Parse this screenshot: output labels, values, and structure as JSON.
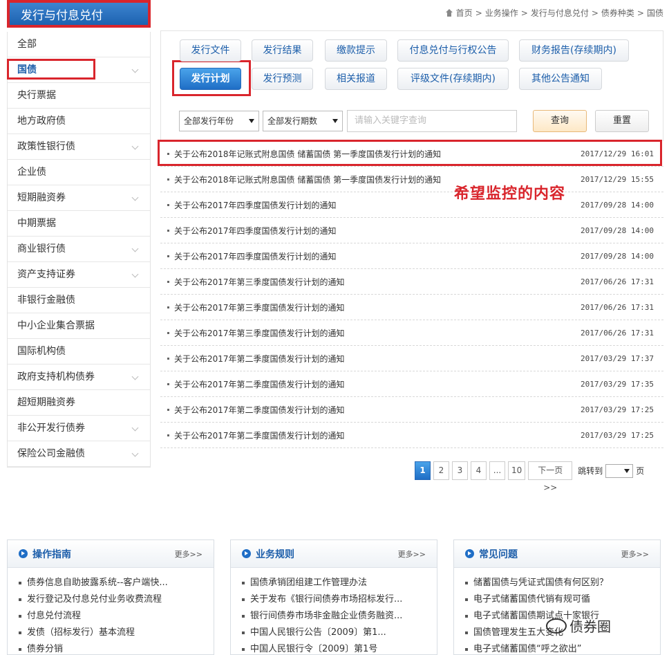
{
  "sidebar": {
    "header": "发行与付息兑付",
    "items": [
      {
        "label": "全部",
        "chevron": false
      },
      {
        "label": "国债",
        "chevron": true,
        "active": true
      },
      {
        "label": "央行票据",
        "chevron": false
      },
      {
        "label": "地方政府债",
        "chevron": false
      },
      {
        "label": "政策性银行债",
        "chevron": true
      },
      {
        "label": "企业债",
        "chevron": false
      },
      {
        "label": "短期融资券",
        "chevron": true
      },
      {
        "label": "中期票据",
        "chevron": false
      },
      {
        "label": "商业银行债",
        "chevron": true
      },
      {
        "label": "资产支持证券",
        "chevron": true
      },
      {
        "label": "非银行金融债",
        "chevron": false
      },
      {
        "label": "中小企业集合票据",
        "chevron": false
      },
      {
        "label": "国际机构债",
        "chevron": false
      },
      {
        "label": "政府支持机构债券",
        "chevron": true
      },
      {
        "label": "超短期融资券",
        "chevron": false
      },
      {
        "label": "非公开发行债券",
        "chevron": true
      },
      {
        "label": "保险公司金融债",
        "chevron": true
      }
    ]
  },
  "breadcrumb": {
    "items": [
      "首页",
      "业务操作",
      "发行与付息兑付",
      "债券种类",
      "国债"
    ],
    "separator": ">"
  },
  "tabs": [
    {
      "label": "发行文件"
    },
    {
      "label": "发行结果"
    },
    {
      "label": "缴款提示"
    },
    {
      "label": "付息兑付与行权公告"
    },
    {
      "label": "财务报告(存续期内)"
    },
    {
      "label": "发行计划",
      "active": true
    },
    {
      "label": "发行预测"
    },
    {
      "label": "相关报道"
    },
    {
      "label": "评级文件(存续期内)"
    },
    {
      "label": "其他公告通知"
    }
  ],
  "filters": {
    "year_select": "全部发行年份",
    "period_select": "全部发行期数",
    "search_placeholder": "请输入关键字查询",
    "query_button": "查询",
    "reset_button": "重置"
  },
  "news": [
    {
      "title": "关于公布2018年记账式附息国债 储蓄国债 第一季度国债发行计划的通知",
      "time": "2017/12/29 16:01"
    },
    {
      "title": "关于公布2018年记账式附息国债 储蓄国债 第一季度国债发行计划的通知",
      "time": "2017/12/29 15:55"
    },
    {
      "title": "关于公布2017年四季度国债发行计划的通知",
      "time": "2017/09/28 14:00"
    },
    {
      "title": "关于公布2017年四季度国债发行计划的通知",
      "time": "2017/09/28 14:00"
    },
    {
      "title": "关于公布2017年四季度国债发行计划的通知",
      "time": "2017/09/28 14:00"
    },
    {
      "title": "关于公布2017年第三季度国债发行计划的通知",
      "time": "2017/06/26 17:31"
    },
    {
      "title": "关于公布2017年第三季度国债发行计划的通知",
      "time": "2017/06/26 17:31"
    },
    {
      "title": "关于公布2017年第三季度国债发行计划的通知",
      "time": "2017/06/26 17:31"
    },
    {
      "title": "关于公布2017年第二季度国债发行计划的通知",
      "time": "2017/03/29 17:37"
    },
    {
      "title": "关于公布2017年第二季度国债发行计划的通知",
      "time": "2017/03/29 17:35"
    },
    {
      "title": "关于公布2017年第二季度国债发行计划的通知",
      "time": "2017/03/29 17:25"
    },
    {
      "title": "关于公布2017年第二季度国债发行计划的通知",
      "time": "2017/03/29 17:25"
    }
  ],
  "annotation": "希望监控的内容",
  "pagination": {
    "pages": [
      "1",
      "2",
      "3",
      "4",
      "...",
      "10"
    ],
    "current": "1",
    "next": "下一页>>",
    "jump_label": "跳转到",
    "page_suffix": "页"
  },
  "bottom_boxes": [
    {
      "title": "操作指南",
      "more": "更多>>",
      "items": [
        "债券信息自助披露系统--客户端快...",
        "发行登记及付息兑付业务收费流程",
        "付息兑付流程",
        "发债（招标发行）基本流程",
        "债券分销"
      ]
    },
    {
      "title": "业务规则",
      "more": "更多>>",
      "items": [
        "国债承销团组建工作管理办法",
        "关于发布《银行间债券市场招标发行...",
        "银行间债券市场非金融企业债务融资...",
        "中国人民银行公告〔2009〕第1...",
        "中国人民银行令〔2009〕第1号"
      ]
    },
    {
      "title": "常见问题",
      "more": "更多>>",
      "items": [
        "储蓄国债与凭证式国债有何区别？",
        "电子式储蓄国债代销有规可循",
        "电子式储蓄国债期试点十家银行",
        "国债管理发生五大变化",
        "电子式储蓄国债“呼之欲出”"
      ]
    }
  ],
  "watermark": "债券圈",
  "colors": {
    "accent_blue": "#1f6ec6",
    "highlight_red": "#d9252c"
  }
}
